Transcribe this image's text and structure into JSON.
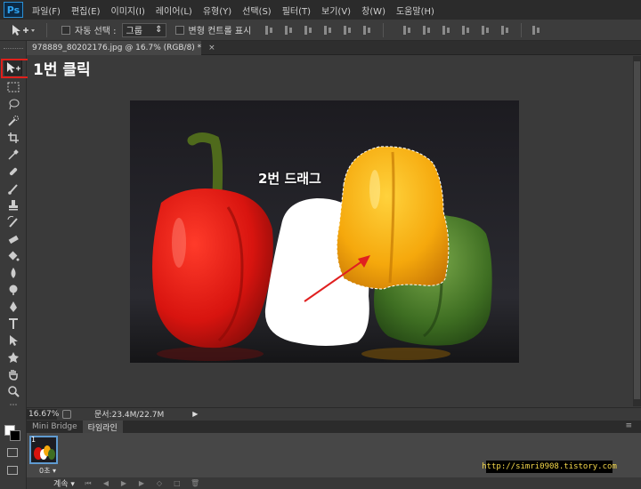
{
  "app": {
    "logo": "Ps"
  },
  "menu": [
    "파일(F)",
    "편집(E)",
    "이미지(I)",
    "레이어(L)",
    "유형(Y)",
    "선택(S)",
    "필터(T)",
    "보기(V)",
    "창(W)",
    "도움말(H)"
  ],
  "options": {
    "auto_select_label": "자동 선택 :",
    "auto_select_value": "그룹",
    "transform_label": "변형 컨트롤 표시"
  },
  "document": {
    "tab_title": "978889_80202176.jpg @ 16.7% (RGB/8) *",
    "close_symbol": "×"
  },
  "annotations": {
    "step1": "1번 클릭",
    "step2": "2번 드래그"
  },
  "status": {
    "zoom": "16.67%",
    "doc_size": "문서:23.4M/22.7M"
  },
  "bottom_panel": {
    "tabs": [
      "Mini Bridge",
      "타임라인"
    ],
    "frame_number": "1",
    "frame_time": "0초",
    "loop": "계속"
  },
  "watermark": "http://simri0908.tistory.com",
  "icons": [
    "move-tool-icon",
    "marquee-icon",
    "lasso-icon",
    "quick-select-icon",
    "crop-icon",
    "eyedropper-icon",
    "healing-icon",
    "brush-icon",
    "stamp-icon",
    "history-brush-icon",
    "eraser-icon",
    "bucket-icon",
    "blur-icon",
    "dodge-icon",
    "pen-icon",
    "type-icon",
    "path-select-icon",
    "shape-icon",
    "hand-icon",
    "zoom-icon"
  ],
  "colors": {
    "highlight_red": "#e0201b",
    "frame_border": "#5f9bd1",
    "watermark_text": "#f5d84a"
  }
}
